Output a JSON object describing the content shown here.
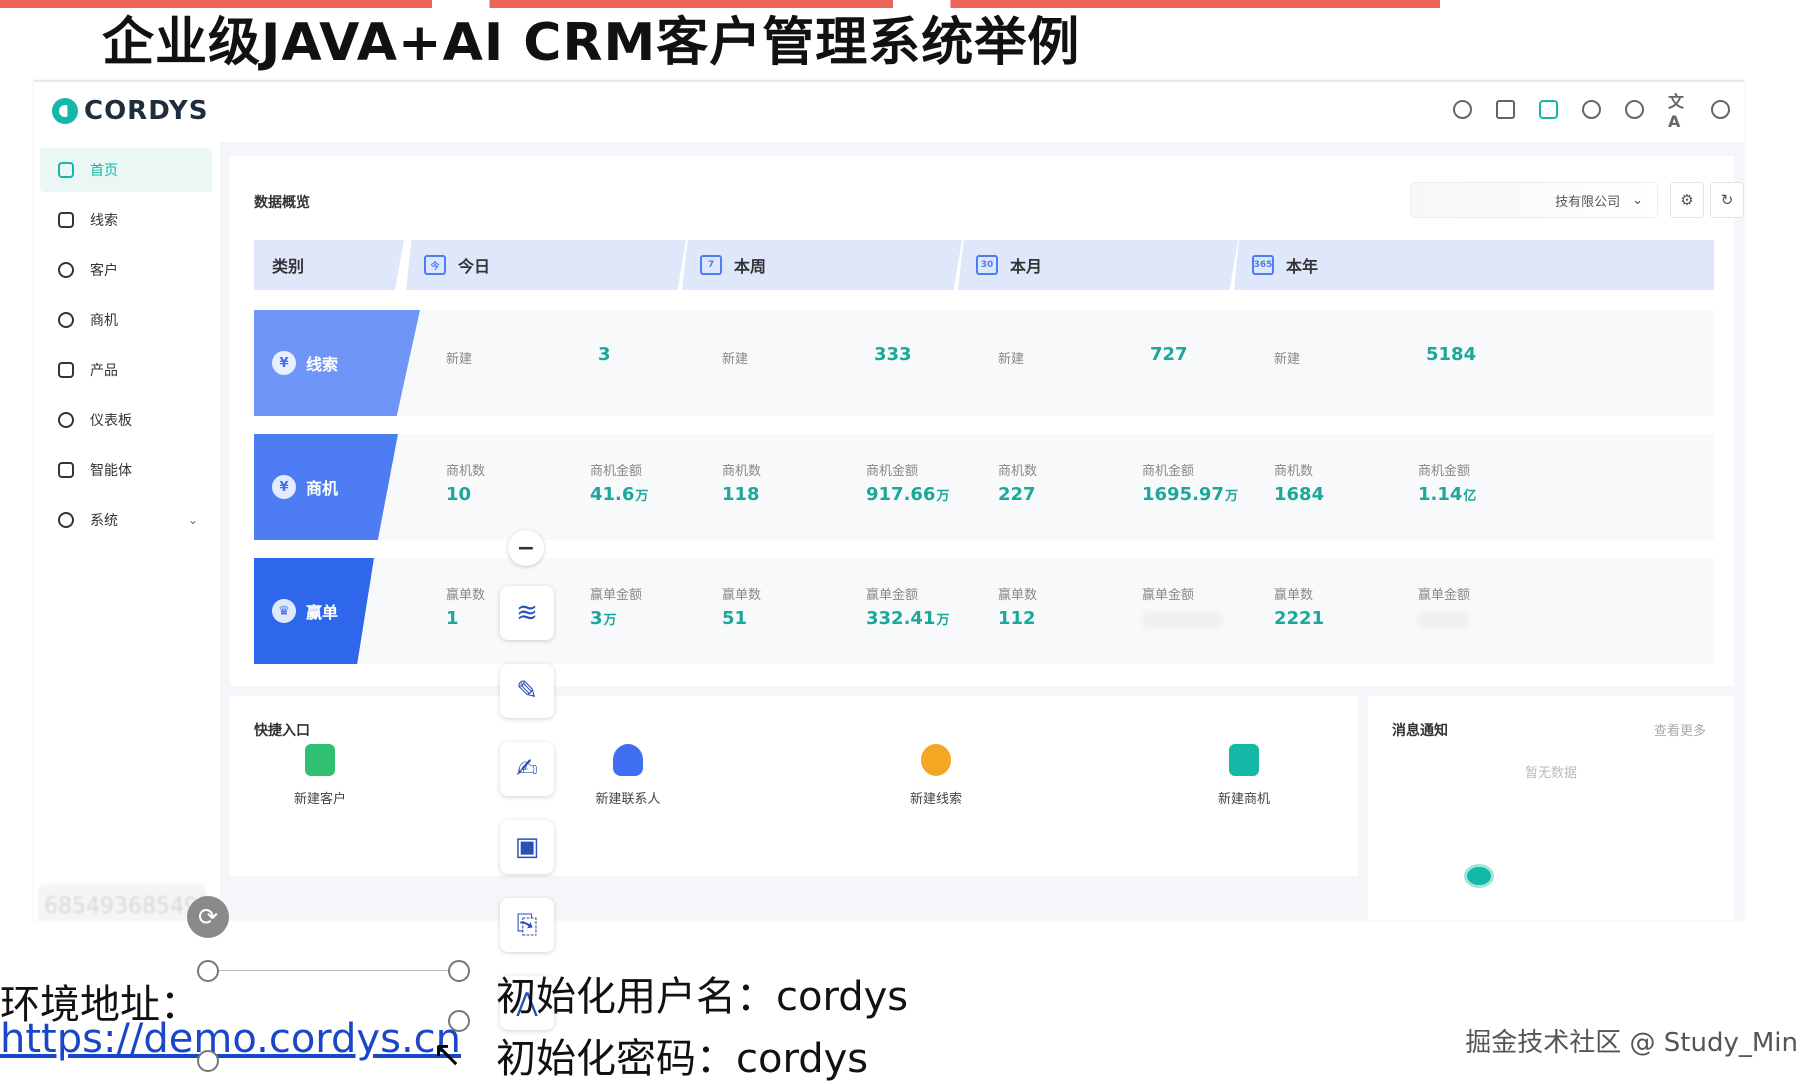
{
  "slide": {
    "title": "企业级JAVA+AI CRM客户管理系统举例"
  },
  "app": {
    "brand": "CORDYS",
    "top_icons": [
      "search-icon",
      "calendar-icon",
      "robot-icon",
      "bell-icon",
      "info-icon",
      "translate-icon",
      "help-icon"
    ],
    "translate_glyph": "文A",
    "accent_color": "#14b8a6",
    "blue_color": "#3f6ff0"
  },
  "sidebar": {
    "items": [
      {
        "label": "首页",
        "icon": "home-icon",
        "active": true
      },
      {
        "label": "线索",
        "icon": "clue-icon"
      },
      {
        "label": "客户",
        "icon": "customer-icon"
      },
      {
        "label": "商机",
        "icon": "opportunity-icon"
      },
      {
        "label": "产品",
        "icon": "product-icon"
      },
      {
        "label": "仪表板",
        "icon": "dashboard-icon"
      },
      {
        "label": "智能体",
        "icon": "agent-icon"
      },
      {
        "label": "系统",
        "icon": "system-icon",
        "expandable": true
      }
    ],
    "user_blur": "685493685493",
    "collapse_glyph": "⇶"
  },
  "overview": {
    "title": "数据概览",
    "company": "技有限公司",
    "settings_glyph": "⚙",
    "refresh_glyph": "↻",
    "headers": [
      {
        "label": "类别"
      },
      {
        "label": "今日",
        "icon_text": "今"
      },
      {
        "label": "本周",
        "icon_text": "7"
      },
      {
        "label": "本月",
        "icon_text": "30"
      },
      {
        "label": "本年",
        "icon_text": "365"
      }
    ],
    "rows": [
      {
        "category": "线索",
        "badge_glyph": "¥",
        "color": "#6f95f7",
        "periods": [
          {
            "l1": "新建",
            "v1": "3"
          },
          {
            "l1": "新建",
            "v1": "333"
          },
          {
            "l1": "新建",
            "v1": "727"
          },
          {
            "l1": "新建",
            "v1": "5184"
          }
        ]
      },
      {
        "category": "商机",
        "badge_glyph": "¥",
        "color": "#4d7cf3",
        "periods": [
          {
            "l1": "商机数",
            "v1": "10",
            "l2": "商机金额",
            "v2": "41.6",
            "u2": "万"
          },
          {
            "l1": "商机数",
            "v1": "118",
            "l2": "商机金额",
            "v2": "917.66",
            "u2": "万"
          },
          {
            "l1": "商机数",
            "v1": "227",
            "l2": "商机金额",
            "v2": "1695.97",
            "u2": "万"
          },
          {
            "l1": "商机数",
            "v1": "1684",
            "l2": "商机金额",
            "v2": "1.14",
            "u2": "亿"
          }
        ]
      },
      {
        "category": "赢单",
        "badge_glyph": "♛",
        "color": "#2f67ec",
        "periods": [
          {
            "l1": "赢单数",
            "v1": "1",
            "l2": "赢单金额",
            "v2": "3",
            "u2": "万"
          },
          {
            "l1": "赢单数",
            "v1": "51",
            "l2": "赢单金额",
            "v2": "332.41",
            "u2": "万"
          },
          {
            "l1": "赢单数",
            "v1": "112",
            "l2": "赢单金额",
            "v2": ""
          },
          {
            "l1": "赢单数",
            "v1": "2221",
            "l2": "赢单金额",
            "v2": ""
          }
        ]
      }
    ]
  },
  "quick": {
    "title": "快捷入口",
    "items": [
      {
        "label": "新建客户",
        "color": "#2fbf71"
      },
      {
        "label": "新建联系人",
        "color": "#3f6ff0"
      },
      {
        "label": "新建线索",
        "color": "#f5a623"
      },
      {
        "label": "新建商机",
        "color": "#14b8a6"
      }
    ]
  },
  "messages": {
    "title": "消息通知",
    "more": "查看更多",
    "empty": "暂无数据"
  },
  "toolbar": {
    "minus": "−",
    "glyphs": [
      "≋",
      "✎",
      "✍",
      "▣",
      "⎘",
      "⋀"
    ]
  },
  "bottom": {
    "env_label": "环境地址：",
    "url": "https://demo.cordys.cn",
    "user_line": "初始化用户名：cordys",
    "pwd_line": "初始化密码：cordys",
    "rotate_glyph": "⟳",
    "cursor_glyph": "↖"
  },
  "watermark": "掘金技术社区 @ Study_Min"
}
